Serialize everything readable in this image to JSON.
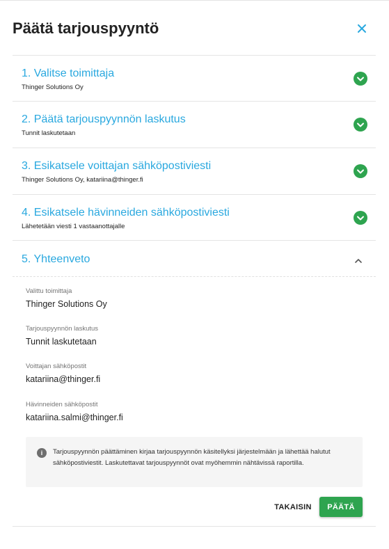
{
  "dialog": {
    "title": "Päätä tarjouspyyntö",
    "close_icon": "close-icon"
  },
  "steps": [
    {
      "number_title": "1. Valitse toimittaja",
      "subtitle": "Thinger Solutions Oy",
      "status": "completed"
    },
    {
      "number_title": "2. Päätä tarjouspyynnön laskutus",
      "subtitle": "Tunnit laskutetaan",
      "status": "completed"
    },
    {
      "number_title": "3. Esikatsele voittajan sähköpostiviesti",
      "subtitle": "Thinger Solutions Oy, katariina@thinger.fi",
      "status": "completed"
    },
    {
      "number_title": "4. Esikatsele hävinneiden sähköpostiviesti",
      "subtitle": "Lähetetään viesti 1 vastaanottajalle",
      "status": "completed"
    }
  ],
  "summary": {
    "title": "5. Yhteenveto",
    "expanded": true,
    "fields": [
      {
        "label": "Valittu toimittaja",
        "value": "Thinger Solutions Oy"
      },
      {
        "label": "Tarjouspyynnön laskutus",
        "value": "Tunnit laskutetaan"
      },
      {
        "label": "Voittajan sähköpostit",
        "value": "katariina@thinger.fi"
      },
      {
        "label": "Hävinneiden sähköpostit",
        "value": "katariina.salmi@thinger.fi"
      }
    ],
    "info_text": "Tarjouspyynnön päättäminen kirjaa tarjouspyynnön käsitellyksi järjestelmään ja lähettää halutut sähköpostiviestit. Laskutettavat tarjouspyynnöt ovat myöhemmin nähtävissä raportilla."
  },
  "actions": {
    "back_label": "TAKAISIN",
    "decide_label": "PÄÄTÄ"
  },
  "colors": {
    "accent": "#29a8df",
    "success": "#2ea44f",
    "info_bg": "#f5f5f5"
  }
}
